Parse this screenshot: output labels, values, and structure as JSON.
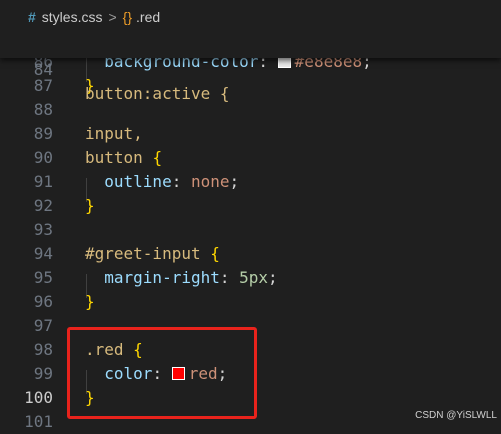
{
  "breadcrumb": {
    "file_icon": "#",
    "file_name": "styles.css",
    "separator": ">",
    "symbol_icon": "{}",
    "symbol_name": ".red"
  },
  "sticky_line": {
    "number": "84",
    "code": "button:active {"
  },
  "lines": [
    {
      "number": "86",
      "property": "background-color",
      "swatch": "#e8e8e8",
      "value": "#e8e8e8"
    },
    {
      "number": "87",
      "brace": "}"
    },
    {
      "number": "88"
    },
    {
      "number": "89",
      "selector": "input,"
    },
    {
      "number": "90",
      "selector": "button",
      "brace": "{"
    },
    {
      "number": "91",
      "property": "outline",
      "value": "none"
    },
    {
      "number": "92",
      "brace": "}"
    },
    {
      "number": "93"
    },
    {
      "number": "94",
      "selector": "#greet-input",
      "brace": "{"
    },
    {
      "number": "95",
      "property": "margin-right",
      "value": "5px"
    },
    {
      "number": "96",
      "brace": "}"
    },
    {
      "number": "97"
    },
    {
      "number": "98",
      "selector": ".red",
      "brace": "{"
    },
    {
      "number": "99",
      "property": "color",
      "swatch": "#ff0000",
      "value": "red"
    },
    {
      "number": "100",
      "brace": "}"
    },
    {
      "number": "101"
    }
  ],
  "punctuation": {
    "colon": ":",
    "semicolon": ";"
  },
  "colors": {
    "highlight_box": "#e8231c",
    "swatch_red": "#ff0000",
    "swatch_light": "#e8e8e8"
  },
  "watermark": "CSDN @YiSLWLL"
}
